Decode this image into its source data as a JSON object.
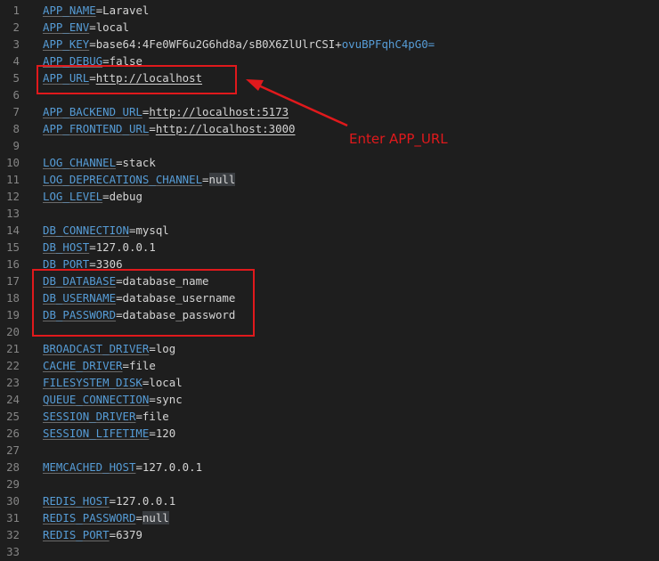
{
  "editor": {
    "lines": [
      {
        "n": "1",
        "key": "APP_NAME",
        "value": "Laravel"
      },
      {
        "n": "2",
        "key": "APP_ENV",
        "value": "local"
      },
      {
        "n": "3",
        "key": "APP_KEY",
        "value": "base64:4Fe0WF6u2G6hd8a/sB0X6ZlUlrCSI+",
        "value2": "ovuBPFqhC4pG0="
      },
      {
        "n": "4",
        "key": "APP_DEBUG",
        "value": "false"
      },
      {
        "n": "5",
        "key": "APP_URL",
        "value": "http://localhost"
      },
      {
        "n": "6"
      },
      {
        "n": "7",
        "key": "APP_BACKEND_URL",
        "value": "http://localhost:5173"
      },
      {
        "n": "8",
        "key": "APP_FRONTEND_URL",
        "value": "http://localhost:3000"
      },
      {
        "n": "9"
      },
      {
        "n": "10",
        "key": "LOG_CHANNEL",
        "value": "stack"
      },
      {
        "n": "11",
        "key": "LOG_DEPRECATIONS_CHANNEL",
        "value": "null"
      },
      {
        "n": "12",
        "key": "LOG_LEVEL",
        "value": "debug"
      },
      {
        "n": "13"
      },
      {
        "n": "14",
        "key": "DB_CONNECTION",
        "value": "mysql"
      },
      {
        "n": "15",
        "key": "DB_HOST",
        "value": "127.0.0.1"
      },
      {
        "n": "16",
        "key": "DB_PORT",
        "value": "3306"
      },
      {
        "n": "17",
        "key": "DB_DATABASE",
        "value": "database_name"
      },
      {
        "n": "18",
        "key": "DB_USERNAME",
        "value": "database_username"
      },
      {
        "n": "19",
        "key": "DB_PASSWORD",
        "value": "database_password"
      },
      {
        "n": "20"
      },
      {
        "n": "21",
        "key": "BROADCAST_DRIVER",
        "value": "log"
      },
      {
        "n": "22",
        "key": "CACHE_DRIVER",
        "value": "file"
      },
      {
        "n": "23",
        "key": "FILESYSTEM_DISK",
        "value": "local"
      },
      {
        "n": "24",
        "key": "QUEUE_CONNECTION",
        "value": "sync"
      },
      {
        "n": "25",
        "key": "SESSION_DRIVER",
        "value": "file"
      },
      {
        "n": "26",
        "key": "SESSION_LIFETIME",
        "value": "120"
      },
      {
        "n": "27"
      },
      {
        "n": "28",
        "key": "MEMCACHED_HOST",
        "value": "127.0.0.1"
      },
      {
        "n": "29"
      },
      {
        "n": "30",
        "key": "REDIS_HOST",
        "value": "127.0.0.1"
      },
      {
        "n": "31",
        "key": "REDIS_PASSWORD",
        "value": "null"
      },
      {
        "n": "32",
        "key": "REDIS_PORT",
        "value": "6379"
      },
      {
        "n": "33"
      }
    ]
  },
  "annotation": {
    "text": "Enter APP_URL",
    "color": "#e0191c"
  },
  "colors": {
    "background": "#1e1e1e",
    "key": "#569cd6",
    "text": "#d4d4d4",
    "line_number": "#858585",
    "highlight": "#3a3d41"
  }
}
